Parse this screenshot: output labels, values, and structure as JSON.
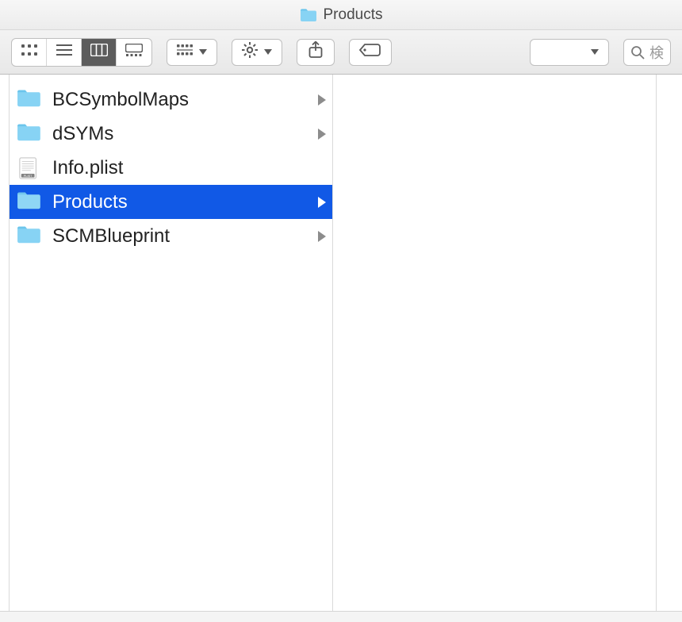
{
  "window": {
    "title": "Products"
  },
  "colors": {
    "selection": "#1159e6",
    "folder": "#87d3f4",
    "folder_tab": "#6cc5ec"
  },
  "toolbar": {
    "view_modes": {
      "icon": "icon-view",
      "list": "list-view",
      "column": "column-view",
      "gallery": "gallery-view",
      "active": "column"
    }
  },
  "search": {
    "placeholder": "検"
  },
  "items": [
    {
      "name": "BCSymbolMaps",
      "kind": "folder",
      "expandable": true,
      "selected": false
    },
    {
      "name": "dSYMs",
      "kind": "folder",
      "expandable": true,
      "selected": false
    },
    {
      "name": "Info.plist",
      "kind": "plist",
      "expandable": false,
      "selected": false
    },
    {
      "name": "Products",
      "kind": "folder",
      "expandable": true,
      "selected": true
    },
    {
      "name": "SCMBlueprint",
      "kind": "folder",
      "expandable": true,
      "selected": false
    }
  ]
}
